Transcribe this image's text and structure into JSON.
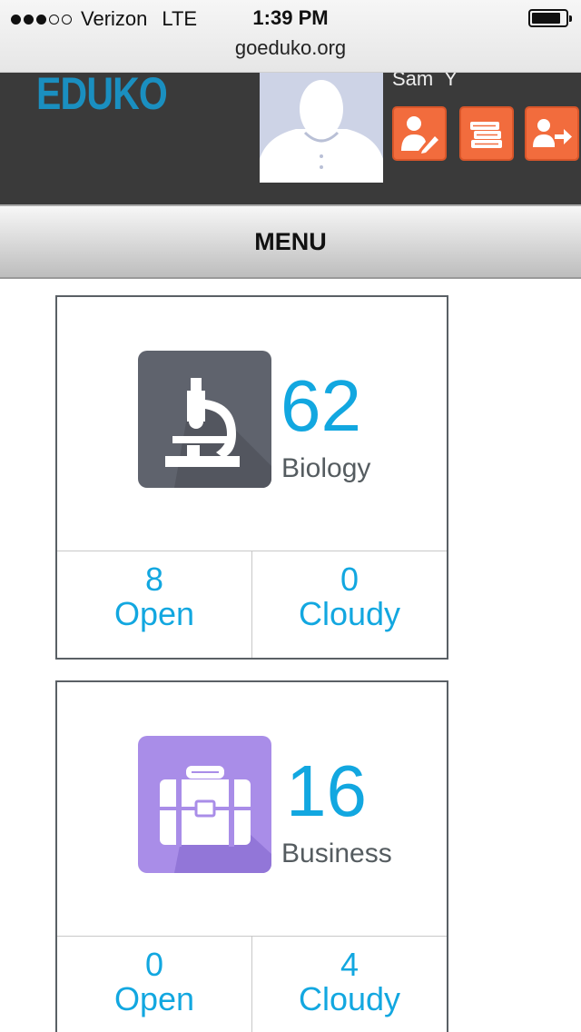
{
  "status_bar": {
    "carrier": "Verizon",
    "network": "LTE",
    "time": "1:39 PM",
    "signal_bars_filled": 3,
    "signal_bars_total": 5,
    "battery_level": 0.86
  },
  "browser": {
    "url": "goeduko.org"
  },
  "header": {
    "logo": "EDUKO",
    "user_name": "Sam  Y",
    "buttons": [
      {
        "icon": "teacher-edit-icon"
      },
      {
        "icon": "books-icon"
      },
      {
        "icon": "logout-icon"
      }
    ],
    "accent_color": "#f26c3d"
  },
  "menu": {
    "label": "MENU"
  },
  "subjects": [
    {
      "count": "62",
      "name": "Biology",
      "icon": "microscope-icon",
      "tile_color": "#5f636d",
      "open_count": "8",
      "open_label": "Open",
      "cloudy_count": "0",
      "cloudy_label": "Cloudy"
    },
    {
      "count": "16",
      "name": "Business",
      "icon": "briefcase-icon",
      "tile_color": "#a98de8",
      "open_count": "0",
      "open_label": "Open",
      "cloudy_count": "4",
      "cloudy_label": "Cloudy"
    }
  ]
}
